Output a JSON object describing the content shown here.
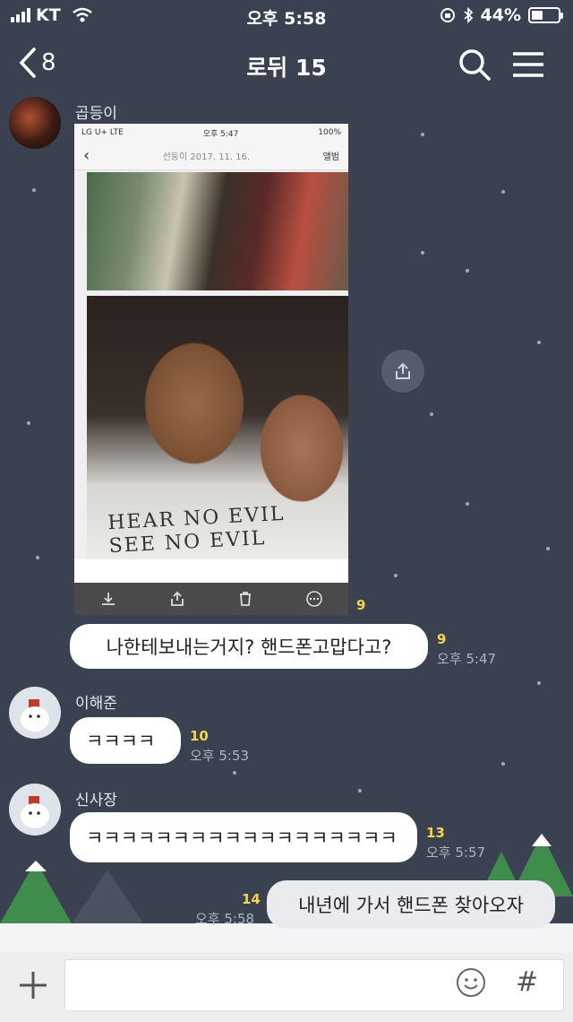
{
  "status_bar": {
    "carrier": "KT",
    "time": "오후 5:58",
    "battery": "44%",
    "battery_level": 0.44
  },
  "header": {
    "back_count": "8",
    "title": "로뒤 15"
  },
  "messages": {
    "m1": {
      "sender": "곱등이",
      "unread": "9",
      "image": {
        "carrier": "LG U+ LTE",
        "time": "오후 5:47",
        "battery": "100%",
        "nav_title": "선둥이 2017. 11. 16.",
        "nav_right": "앨범",
        "shirt_text_1": "HEAR NO EVIL",
        "shirt_text_2": "SEE NO EVIL"
      }
    },
    "m2": {
      "text": "나한테보내는거지? 핸드폰고맙다고?",
      "unread": "9",
      "time": "오후 5:47"
    },
    "m3": {
      "sender": "이해준",
      "text": "ㅋㅋㅋㅋ",
      "unread": "10",
      "time": "오후 5:53"
    },
    "m4": {
      "sender": "신사장",
      "text": "ㅋㅋㅋㅋㅋㅋㅋㅋㅋㅋㅋㅋㅋㅋㅋㅋㅋㅋ",
      "unread": "13",
      "time": "오후 5:57"
    },
    "m5": {
      "text": "내년에 가서 핸드폰 찾아오자",
      "unread": "14",
      "time": "오후 5:58"
    }
  },
  "input_bar": {
    "hash": "#"
  },
  "colors": {
    "bg": "#3a4150",
    "unread": "#f6d64a",
    "bubble": "#ffffff"
  }
}
